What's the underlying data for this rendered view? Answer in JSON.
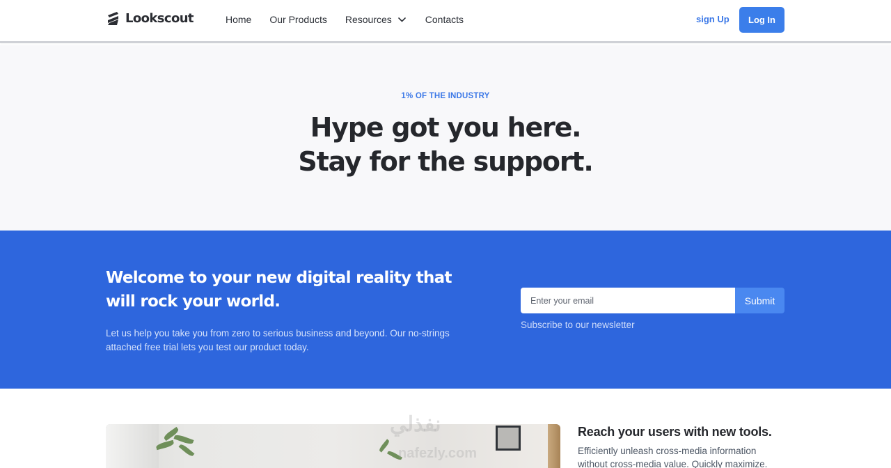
{
  "brand": {
    "name": "Lookscout"
  },
  "nav": {
    "home": "Home",
    "products": "Our Products",
    "resources": "Resources",
    "contacts": "Contacts"
  },
  "auth": {
    "signup": "sign Up",
    "login": "Log In"
  },
  "hero": {
    "eyebrow": "1% OF THE INDUSTRY",
    "headline_line1": "Hype got you here.",
    "headline_line2": "Stay for the support."
  },
  "band": {
    "title": "Welcome to your new digital reality that will rock your world.",
    "text": "Let us help you take you from zero to serious business and beyond. Our no-strings attached free trial lets you test our product today.",
    "email_placeholder": "Enter your email",
    "submit": "Submit",
    "newsletter": "Subscribe to our newsletter"
  },
  "feature": {
    "title": "Reach your users with new tools.",
    "text": "Efficiently unleash cross-media information without cross-media value. Quickly maximize."
  },
  "watermark": {
    "arabic": "نفذلي",
    "url": "nafezly.com"
  },
  "colors": {
    "accent": "#3b7eea",
    "band": "#2e66dd",
    "heading": "#25272c"
  }
}
